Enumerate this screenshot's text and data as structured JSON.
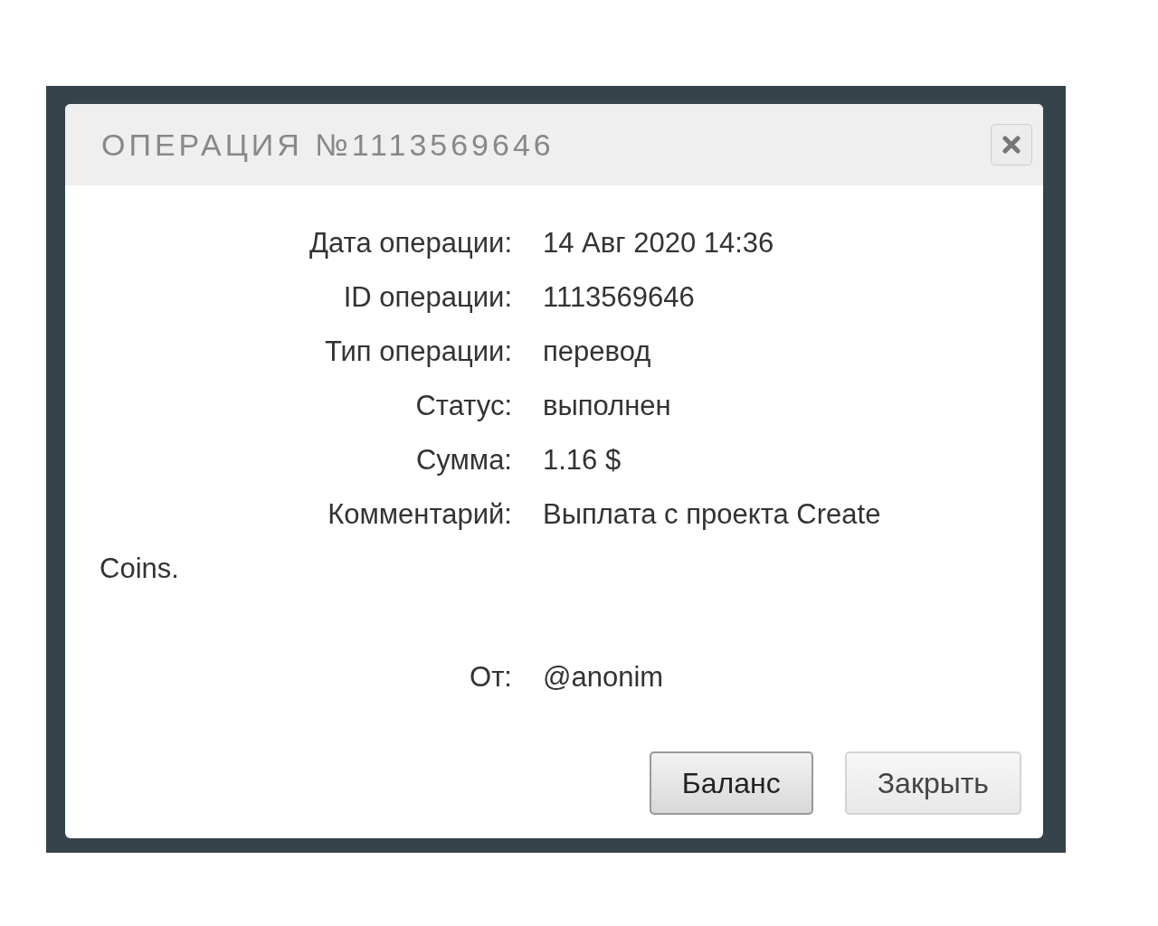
{
  "dialog": {
    "title": "ОПЕРАЦИЯ №1113569646",
    "fields": [
      {
        "label": "Дата операции:",
        "value": "14 Авг 2020 14:36",
        "kind": "line"
      },
      {
        "label": "ID операции:",
        "value": "1113569646",
        "kind": "line"
      },
      {
        "label": "Тип операции:",
        "value": "перевод",
        "kind": "line"
      },
      {
        "label": "Статус:",
        "value": "выполнен",
        "kind": "line"
      },
      {
        "label": "Сумма:",
        "value": "1.16 $",
        "kind": "line"
      },
      {
        "label": "Комментарий:",
        "value": "Выплата с проекта Create Coins.",
        "kind": "note"
      },
      {
        "label": "От:",
        "value": "@anonim",
        "kind": "line"
      }
    ],
    "buttons": [
      {
        "label": "Баланс",
        "kind": "primary"
      },
      {
        "label": "Закрыть",
        "kind": "secondary"
      }
    ]
  }
}
